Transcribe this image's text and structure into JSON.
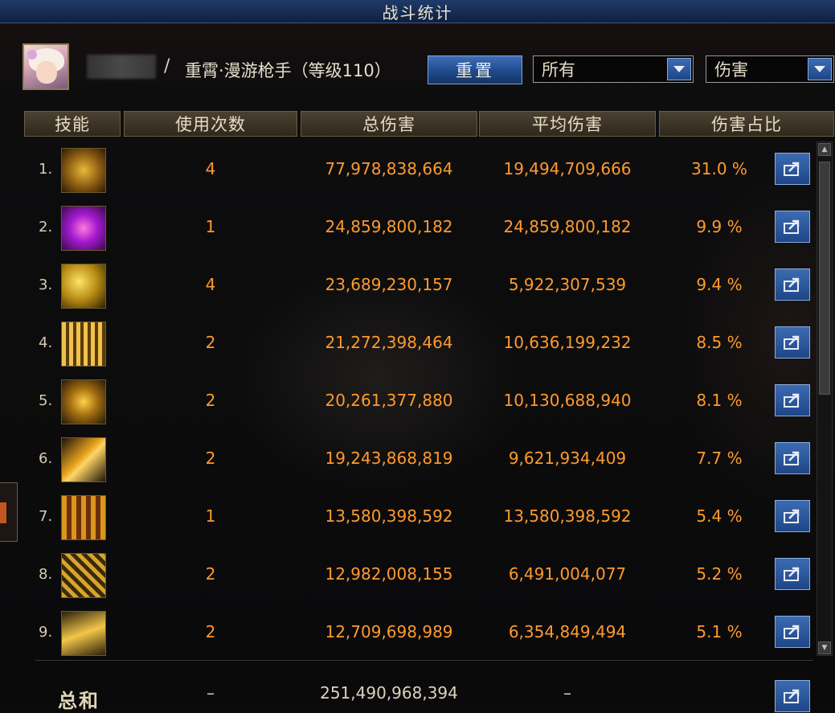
{
  "window": {
    "title": "战斗统计"
  },
  "header": {
    "player_name": "",
    "separator": "/",
    "character_info": "重霄·漫游枪手（等级110）",
    "reset_label": "重置",
    "filter_value": "所有",
    "metric_value": "伤害"
  },
  "table": {
    "headers": [
      "技能",
      "使用次数",
      "总伤害",
      "平均伤害",
      "伤害占比"
    ],
    "rows": [
      {
        "rank": "1.",
        "icon": "skill-icon-1",
        "count": "4",
        "total": "77,978,838,664",
        "avg": "19,494,709,666",
        "pct": "31.0 %"
      },
      {
        "rank": "2.",
        "icon": "skill-icon-2",
        "count": "1",
        "total": "24,859,800,182",
        "avg": "24,859,800,182",
        "pct": "9.9 %"
      },
      {
        "rank": "3.",
        "icon": "skill-icon-3",
        "count": "4",
        "total": "23,689,230,157",
        "avg": "5,922,307,539",
        "pct": "9.4 %"
      },
      {
        "rank": "4.",
        "icon": "skill-icon-4",
        "count": "2",
        "total": "21,272,398,464",
        "avg": "10,636,199,232",
        "pct": "8.5 %"
      },
      {
        "rank": "5.",
        "icon": "skill-icon-5",
        "count": "2",
        "total": "20,261,377,880",
        "avg": "10,130,688,940",
        "pct": "8.1 %"
      },
      {
        "rank": "6.",
        "icon": "skill-icon-6",
        "count": "2",
        "total": "19,243,868,819",
        "avg": "9,621,934,409",
        "pct": "7.7 %"
      },
      {
        "rank": "7.",
        "icon": "skill-icon-7",
        "count": "1",
        "total": "13,580,398,592",
        "avg": "13,580,398,592",
        "pct": "5.4 %"
      },
      {
        "rank": "8.",
        "icon": "skill-icon-8",
        "count": "2",
        "total": "12,982,008,155",
        "avg": "6,491,004,077",
        "pct": "5.2 %"
      },
      {
        "rank": "9.",
        "icon": "skill-icon-9",
        "count": "2",
        "total": "12,709,698,989",
        "avg": "6,354,849,494",
        "pct": "5.1 %"
      }
    ],
    "total": {
      "label": "总和",
      "count": "–",
      "total": "251,490,968,394",
      "avg": "–"
    }
  },
  "colors": {
    "value_orange": "#ff9a2e",
    "button_blue": "#1f4a8c",
    "header_bronze": "#3a3224",
    "title_bar": "#162c52"
  }
}
